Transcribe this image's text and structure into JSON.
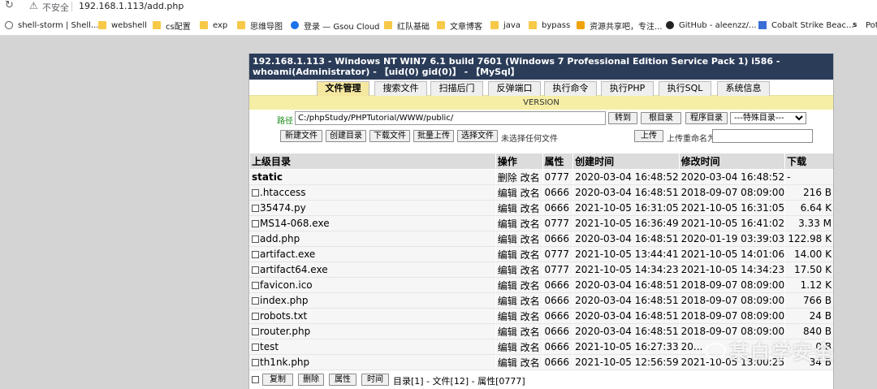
{
  "browser": {
    "insecure_label": "不安全",
    "url": "192.168.1.113/add.php",
    "bookmarks": [
      {
        "label": "shell-storm | Shell...",
        "icon": "globe-icon"
      },
      {
        "label": "webshell",
        "icon": "folder-icon"
      },
      {
        "label": "cs配置",
        "icon": "folder-icon"
      },
      {
        "label": "exp",
        "icon": "folder-icon"
      },
      {
        "label": "思维导图",
        "icon": "folder-icon"
      },
      {
        "label": "登录 — Gsou Cloud",
        "icon": "gsou-icon"
      },
      {
        "label": "红队基础",
        "icon": "folder-icon"
      },
      {
        "label": "文章博客",
        "icon": "folder-icon"
      },
      {
        "label": "java",
        "icon": "folder-icon"
      },
      {
        "label": "bypass",
        "icon": "folder-icon"
      },
      {
        "label": "资源共享吧，专注...",
        "icon": "rss-icon"
      },
      {
        "label": "GitHub - aleenzz/...",
        "icon": "github-icon"
      },
      {
        "label": "Cobalt Strike Beac...",
        "icon": "cs-icon"
      },
      {
        "label": "Pot",
        "icon": "s-icon"
      }
    ]
  },
  "shell": {
    "title": "192.168.1.113 - Windows NT WIN7 6.1 build 7601 (Windows 7 Professional Edition Service Pack 1) i586 - whoami(Administrator) - 【uid(0) gid(0)】 - 【MySql】",
    "tabs": [
      "文件管理",
      "搜索文件",
      "扫描后门",
      "反弹端口",
      "执行命令",
      "执行PHP",
      "执行SQL",
      "系统信息"
    ],
    "version": "VERSION",
    "path_label": "路径",
    "path_value": "C:/phpStudy/PHPTutorial/WWW/public/",
    "goto_btn": "转到",
    "root_btn": "根目录",
    "progdir_btn": "程序目录",
    "special_select": "---特殊目录---",
    "new_file_btn": "新建文件",
    "new_dir_btn": "创建目录",
    "download_btn": "下载文件",
    "batch_upload_btn": "批量上传",
    "choose_file_btn": "选择文件",
    "no_file_text": "未选择任何文件",
    "upload_btn": "上传",
    "rename_label": "上传重命名为",
    "columns": [
      "上级目录",
      "操作",
      "属性",
      "创建时间",
      "修改时间",
      "下载"
    ],
    "rows": [
      {
        "name": "static",
        "ops": "删除 改名",
        "attr": "0777",
        "created": "2020-03-04 16:48:52",
        "modified": "2020-03-04 16:48:52",
        "size": "-",
        "is_dir": true
      },
      {
        "name": ".htaccess",
        "ops": "编辑 改名",
        "attr": "0666",
        "created": "2020-03-04 16:48:51",
        "modified": "2018-09-07 08:09:00",
        "size": "216 B"
      },
      {
        "name": "35474.py",
        "ops": "编辑 改名",
        "attr": "0666",
        "created": "2021-10-05 16:31:05",
        "modified": "2021-10-05 16:31:05",
        "size": "6.64 K"
      },
      {
        "name": "MS14-068.exe",
        "ops": "编辑 改名",
        "attr": "0777",
        "created": "2021-10-05 16:36:49",
        "modified": "2021-10-05 16:41:02",
        "size": "3.33 M"
      },
      {
        "name": "add.php",
        "ops": "编辑 改名",
        "attr": "0666",
        "created": "2020-03-04 16:48:51",
        "modified": "2020-01-19 03:39:03",
        "size": "122.98 K"
      },
      {
        "name": "artifact.exe",
        "ops": "编辑 改名",
        "attr": "0777",
        "created": "2021-10-05 13:44:41",
        "modified": "2021-10-05 14:01:06",
        "size": "14.00 K"
      },
      {
        "name": "artifact64.exe",
        "ops": "编辑 改名",
        "attr": "0777",
        "created": "2021-10-05 14:34:23",
        "modified": "2021-10-05 14:34:23",
        "size": "17.50 K"
      },
      {
        "name": "favicon.ico",
        "ops": "编辑 改名",
        "attr": "0666",
        "created": "2020-03-04 16:48:51",
        "modified": "2018-09-07 08:09:00",
        "size": "1.12 K"
      },
      {
        "name": "index.php",
        "ops": "编辑 改名",
        "attr": "0666",
        "created": "2020-03-04 16:48:51",
        "modified": "2018-09-07 08:09:00",
        "size": "766 B"
      },
      {
        "name": "robots.txt",
        "ops": "编辑 改名",
        "attr": "0666",
        "created": "2020-03-04 16:48:51",
        "modified": "2018-09-07 08:09:00",
        "size": "24 B"
      },
      {
        "name": "router.php",
        "ops": "编辑 改名",
        "attr": "0666",
        "created": "2020-03-04 16:48:51",
        "modified": "2018-09-07 08:09:00",
        "size": "840 B"
      },
      {
        "name": "test",
        "ops": "编辑 改名",
        "attr": "0666",
        "created": "2021-10-05 16:27:33",
        "modified": "20...",
        "size": "0 B"
      },
      {
        "name": "th1nk.php",
        "ops": "编辑 改名",
        "attr": "0666",
        "created": "2021-10-05 12:56:59",
        "modified": "2021-10-05 13:00:25",
        "size": "34 B"
      }
    ],
    "copy_btn": "复制",
    "delete_btn": "删除",
    "attr_btn": "属性",
    "time_btn": "时间",
    "summary": "目录[1] - 文件[12] - 属性[0777]"
  },
  "watermark": "某白学安全",
  "colors": {
    "title_bg": "#2b3c59",
    "tab_active": "#f4e7a0",
    "version_bar": "#f5eea4",
    "header_bg": "#dcdcdc",
    "path_label": "#1a8a1a"
  }
}
